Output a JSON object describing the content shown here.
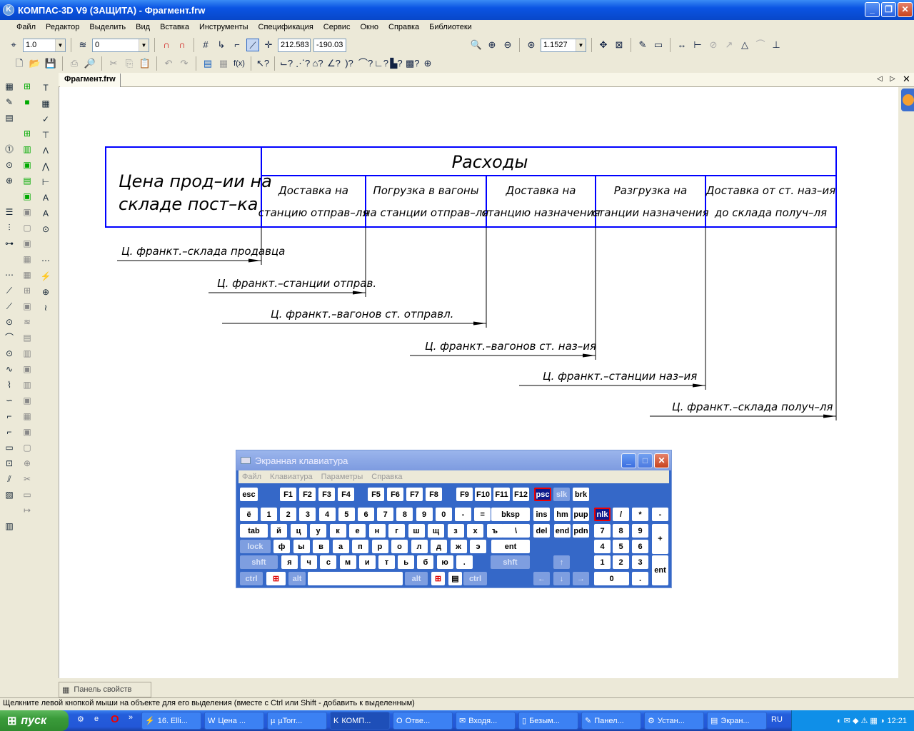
{
  "window": {
    "title": "КОМПАС-3D V9 (ЗАЩИТА) - Фрагмент.frw"
  },
  "menu": [
    "Файл",
    "Редактор",
    "Выделить",
    "Вид",
    "Вставка",
    "Инструменты",
    "Спецификация",
    "Сервис",
    "Окно",
    "Справка",
    "Библиотеки"
  ],
  "toolbar": {
    "step": "1.0",
    "layer": "0",
    "coord_x": "212.583",
    "coord_y": "-190.03",
    "zoom": "1.1527",
    "fx_label": "f(x)"
  },
  "doc_tab": "Фрагмент.frw",
  "drawing": {
    "header_left": [
      "Цена прод–ии на",
      "складе пост–ка"
    ],
    "header_main": "Расходы",
    "columns": [
      [
        "Доставка на",
        "станцию отправ–ля"
      ],
      [
        "Погрузка в вагоны",
        "на станции отправ–ля"
      ],
      [
        "Доставка на",
        "станцию назначения"
      ],
      [
        "Разгрузка на",
        "станции назначения"
      ],
      [
        "Доставка от ст. наз–ия",
        "до склада получ–ля"
      ]
    ],
    "arrows": [
      "Ц. франкт.–склада продавца",
      "Ц. франкт.–станции отправ.",
      "Ц. франкт.–вагонов ст. отправл.",
      "Ц. франкт.–вагонов ст. наз–ия",
      "Ц. франкт.–станции наз–ия",
      "Ц. франкт.–склада получ–ля"
    ],
    "line_color": "#0000ff"
  },
  "osk": {
    "title": "Экранная клавиатура",
    "menu": [
      "Файл",
      "Клавиатура",
      "Параметры",
      "Справка"
    ],
    "keys": [
      "esc",
      "F1",
      "F2",
      "F3",
      "F4",
      "F5",
      "F6",
      "F7",
      "F8",
      "F9",
      "F10",
      "F11",
      "F12",
      "psc",
      "slk",
      "brk",
      "ё",
      "1",
      "2",
      "3",
      "4",
      "5",
      "6",
      "7",
      "8",
      "9",
      "0",
      "-",
      "=",
      "bksp",
      "ins",
      "hm",
      "pup",
      "nlk",
      "/",
      "*",
      "-",
      "tab",
      "й",
      "ц",
      "у",
      "к",
      "е",
      "н",
      "г",
      "ш",
      "щ",
      "з",
      "х",
      "ъ",
      "\\",
      "del",
      "end",
      "pdn",
      "7",
      "8",
      "9",
      "+",
      "lock",
      "ф",
      "ы",
      "в",
      "а",
      "п",
      "р",
      "о",
      "л",
      "д",
      "ж",
      "э",
      "ent",
      "4",
      "5",
      "6",
      "shft",
      "я",
      "ч",
      "с",
      "м",
      "и",
      "т",
      "ь",
      "б",
      "ю",
      ".",
      "shft",
      "↑",
      "1",
      "2",
      "3",
      "ent",
      "ctrl",
      "⊞",
      "alt",
      "",
      "alt",
      "⊞",
      "▤",
      "ctrl",
      "←",
      "↓",
      "→",
      "0",
      "."
    ]
  },
  "properties_panel": "Панель свойств",
  "status": "Щелкните левой кнопкой мыши на объекте для его выделения (вместе с Ctrl или Shift - добавить к выделенным)",
  "taskbar": {
    "start": "пуск",
    "tasks": [
      "16. Elli...",
      "Цена ...",
      "µTorr...",
      "КОМП...",
      "Отве...",
      "Входя...",
      "Безым...",
      "Панел...",
      "Устан...",
      "Экран..."
    ],
    "lang": "RU",
    "clock": "12:21"
  }
}
